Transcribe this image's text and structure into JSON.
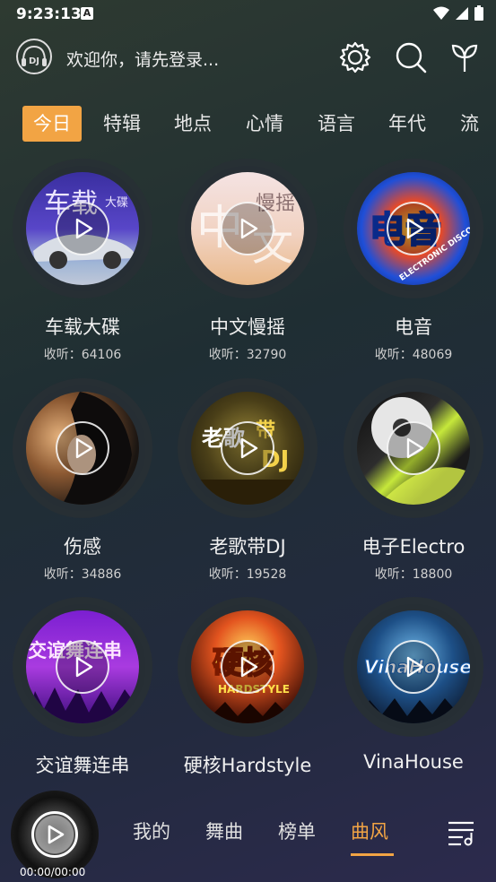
{
  "status_bar": {
    "time": "9:23:13",
    "indicator": "A"
  },
  "header": {
    "logo_text": "DJ",
    "welcome": "欢迎你，请先登录..."
  },
  "tabs": [
    {
      "label": "今日",
      "active": true
    },
    {
      "label": "特辑"
    },
    {
      "label": "地点"
    },
    {
      "label": "心情"
    },
    {
      "label": "语言"
    },
    {
      "label": "年代"
    },
    {
      "label": "流"
    }
  ],
  "grid": [
    {
      "title": "车载大碟",
      "count": "收听：64106",
      "art_text": "车载 大碟"
    },
    {
      "title": "中文慢摇",
      "count": "收听：32790",
      "art_text": "中文 慢摇"
    },
    {
      "title": "电音",
      "count": "收听：48069",
      "art_text": "电音 ELECTRONIC DISCO"
    },
    {
      "title": "伤感",
      "count": "收听：34886",
      "art_text": ""
    },
    {
      "title": "老歌带DJ",
      "count": "收听：19528",
      "art_text": "老歌 带 DJ"
    },
    {
      "title": "电子Electro",
      "count": "收听：18800",
      "art_text": ""
    },
    {
      "title": "交谊舞连串",
      "count": "",
      "art_text": "交谊舞连串"
    },
    {
      "title": "硬核Hardstyle",
      "count": "",
      "art_text": "硬核 HARDSTYLE"
    },
    {
      "title": "VinaHouse",
      "count": "",
      "art_text": "VinaHouse"
    }
  ],
  "player": {
    "time": "00:00/00:00"
  },
  "bottom_nav": [
    {
      "label": "我的"
    },
    {
      "label": "舞曲"
    },
    {
      "label": "榜单"
    },
    {
      "label": "曲风",
      "active": true
    }
  ],
  "colors": {
    "accent": "#f2a444"
  }
}
